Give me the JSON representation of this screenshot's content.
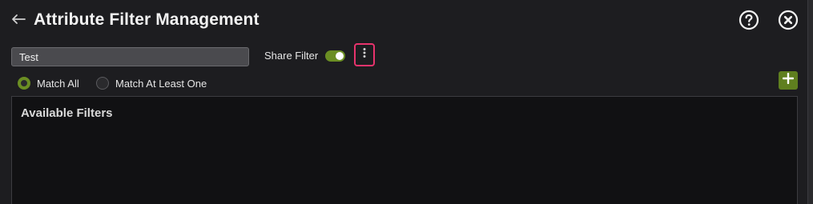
{
  "header": {
    "back_icon": "arrow-left-icon",
    "title": "Attribute Filter Management",
    "help_icon": "question-circle-icon",
    "close_icon": "close-circle-icon"
  },
  "filter": {
    "name_value": "Test",
    "share_label": "Share Filter",
    "share_enabled": true,
    "more_icon": "more-vertical-icon"
  },
  "match": {
    "options": [
      {
        "label": "Match All",
        "selected": true
      },
      {
        "label": "Match At Least One",
        "selected": false
      }
    ],
    "add_icon": "plus-icon"
  },
  "panel": {
    "title": "Available Filters"
  },
  "colors": {
    "background": "#1d1d20",
    "accent": "#6b8e23",
    "highlight": "#e8336d",
    "panel_bg": "#111113"
  }
}
